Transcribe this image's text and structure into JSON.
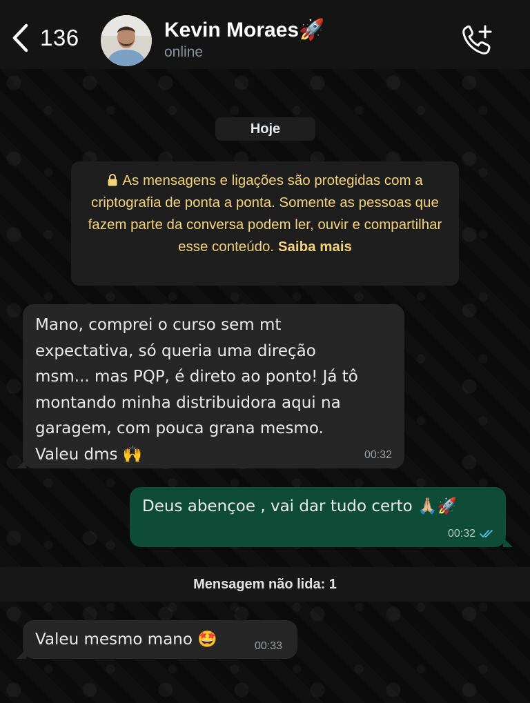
{
  "header": {
    "back_count": "136",
    "contact_name": "Kevin Moraes🚀",
    "status": "online"
  },
  "chat": {
    "date_chip": "Hoje",
    "encryption_notice": "As mensagens e ligações são protegidas com a criptografia de ponta a ponta. Somente as pessoas que fazem parte da conversa podem ler, ouvir e compartilhar esse conteúdo.",
    "encryption_link": "Saiba mais",
    "unread_divider": "Mensagem não lida: 1",
    "messages": [
      {
        "direction": "incoming",
        "text": " Mano, comprei o curso sem mt\nexpectativa, só queria uma direção\nmsm... mas PQP, é direto ao ponto! Já tô\nmontando minha distribuidora aqui na\ngaragem, com pouca grana mesmo.\nValeu dms 🙌",
        "time": "00:32"
      },
      {
        "direction": "outgoing",
        "text": "Deus abençoe , vai dar tudo certo 🙏🏼🚀",
        "time": "00:32",
        "status": "read"
      },
      {
        "direction": "incoming",
        "text": "Valeu mesmo mano 🤩",
        "time": "00:33"
      }
    ]
  },
  "colors": {
    "header_bg": "#141414",
    "incoming_bubble": "#262626",
    "outgoing_bubble": "#0f4c37",
    "notice_text": "#f3d27a",
    "read_ticks": "#53bdeb"
  }
}
